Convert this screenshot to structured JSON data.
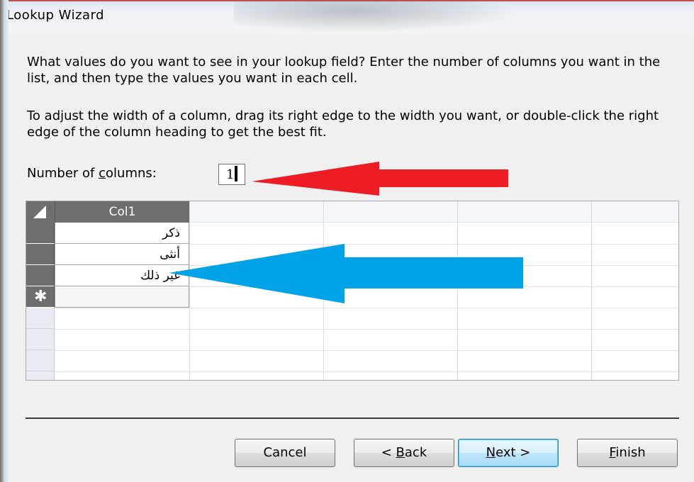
{
  "window": {
    "title": "Lookup Wizard"
  },
  "instructions": {
    "paragraph1": "What values do you want to see in your lookup field? Enter the number of columns you want in the list, and then type the values you want in each cell.",
    "paragraph2": "To adjust the width of a column, drag its right edge to the width you want, or double-click the right edge of the column heading to get the best fit."
  },
  "columns_field": {
    "label_before": "Number of ",
    "label_accel": "c",
    "label_after": "olumns:",
    "value": "1"
  },
  "grid": {
    "column_header": "Col1",
    "rows": [
      "ذكر",
      "أنثى",
      "غير ذلك"
    ],
    "new_row_marker": "✱"
  },
  "buttons": {
    "cancel": "Cancel",
    "back_prefix": "< ",
    "back_accel": "B",
    "back_rest": "ack",
    "next_accel": "N",
    "next_rest": "ext >",
    "finish_accel": "F",
    "finish_rest": "inish"
  },
  "colors": {
    "red_arrow": "#ee1c25",
    "blue_arrow": "#00a2e8",
    "header_dark": "#6e6e6e",
    "title_accent": "#c0504d"
  },
  "icons": {
    "red_arrow": "arrow-left-icon",
    "blue_arrow": "arrow-left-icon",
    "select_all": "triangle-icon",
    "new_record": "asterisk-icon"
  }
}
